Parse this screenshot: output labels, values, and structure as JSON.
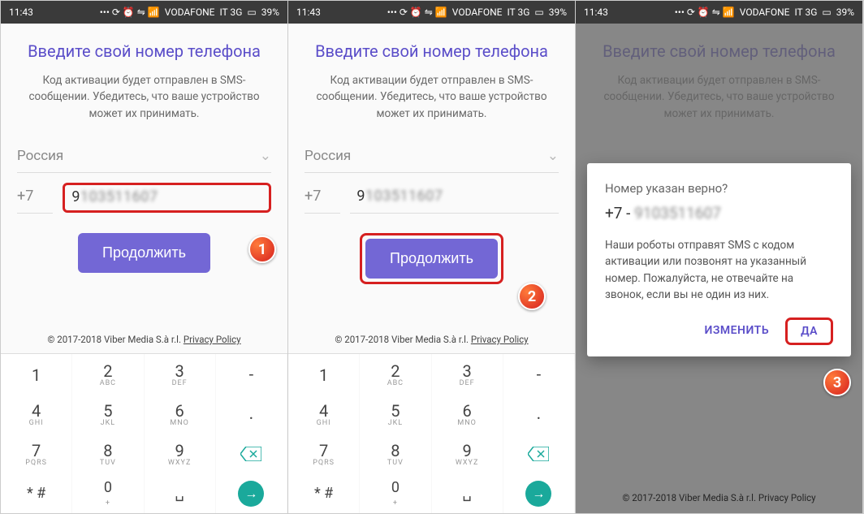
{
  "statusbar": {
    "time": "11:43",
    "carrier": "VODAFONE",
    "network": "IT 3G",
    "battery": "39%"
  },
  "screen": {
    "title": "Введите свой номер телефона",
    "subtitle": "Код активации будет отправлен в SMS-сообщении. Убедитесь, что ваше устройство может их принимать.",
    "country": "Россия",
    "prefix": "+7",
    "number_first": "9",
    "number_rest": "103511607",
    "continue": "Продолжить",
    "footer_copyright": "© 2017-2018 Viber Media S.à r.l. ",
    "footer_privacy": "Privacy Policy"
  },
  "dialog": {
    "title": "Номер указан верно?",
    "number_prefix": "+7 - ",
    "number_rest": "9103511607",
    "text": "Наши роботы отправят SMS с кодом активации или позвонят на указанный номер. Пожалуйста, не отвечайте на звонок, если вы не один из них.",
    "change": "ИЗМЕНИТЬ",
    "yes": "ДА"
  },
  "keypad": {
    "rows": [
      [
        {
          "n": "1",
          "l": ""
        },
        {
          "n": "2",
          "l": "ABC"
        },
        {
          "n": "3",
          "l": "DEF"
        },
        {
          "n": "-",
          "l": ""
        }
      ],
      [
        {
          "n": "4",
          "l": "GHI"
        },
        {
          "n": "5",
          "l": "JKL"
        },
        {
          "n": "6",
          "l": "MNO"
        },
        {
          "n": ".",
          "l": ""
        }
      ],
      [
        {
          "n": "7",
          "l": "PQRS"
        },
        {
          "n": "8",
          "l": "TUV"
        },
        {
          "n": "9",
          "l": "WXYZ"
        },
        {
          "n": "⌫",
          "l": ""
        }
      ],
      [
        {
          "n": "* #",
          "l": ""
        },
        {
          "n": "0",
          "l": "+"
        },
        {
          "n": "⎵",
          "l": ""
        },
        {
          "n": "→",
          "l": ""
        }
      ]
    ]
  },
  "badges": {
    "one": "1",
    "two": "2",
    "three": "3"
  }
}
